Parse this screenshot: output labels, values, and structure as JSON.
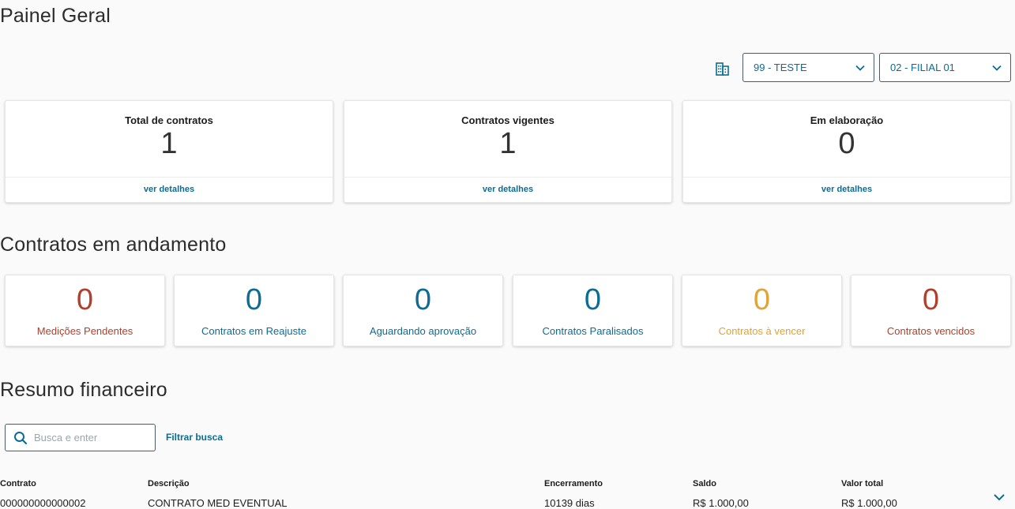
{
  "page_title": "Painel Geral",
  "selects": {
    "company": "99 - TESTE",
    "branch": "02 - FILIAL 01"
  },
  "summary_cards": [
    {
      "title": "Total de contratos",
      "value": "1",
      "link": "ver detalhes"
    },
    {
      "title": "Contratos vigentes",
      "value": "1",
      "link": "ver detalhes"
    },
    {
      "title": "Em elaboração",
      "value": "0",
      "link": "ver detalhes"
    }
  ],
  "in_progress": {
    "title": "Contratos em andamento",
    "cards": [
      {
        "value": "0",
        "label": "Medições Pendentes",
        "color": "#b0402c"
      },
      {
        "value": "0",
        "label": "Contratos em Reajuste",
        "color": "#0c6c94"
      },
      {
        "value": "0",
        "label": "Aguardando aprovação",
        "color": "#0c6c94"
      },
      {
        "value": "0",
        "label": "Contratos Paralisados",
        "color": "#0c6c94"
      },
      {
        "value": "0",
        "label": "Contratos à vencer",
        "color": "#e2a236"
      },
      {
        "value": "0",
        "label": "Contratos vencidos",
        "color": "#b0402c"
      }
    ]
  },
  "financial": {
    "title": "Resumo financeiro",
    "search_placeholder": "Busca e enter",
    "filter_label": "Filtrar busca",
    "columns": [
      "Contrato",
      "Descrição",
      "Encerramento",
      "Saldo",
      "Valor total"
    ],
    "rows": [
      [
        "000000000000002",
        "CONTRATO MED EVENTUAL",
        "10139 dias",
        "R$ 1.000,00",
        "R$ 1.000,00"
      ]
    ]
  },
  "icons": {
    "branch": "building-icon",
    "dropdown": "chevron-down-icon",
    "search": "search-icon",
    "expand": "chevron-down-icon"
  },
  "colors": {
    "primary": "#0c6c94",
    "danger": "#b0402c",
    "warning": "#e2a236"
  }
}
